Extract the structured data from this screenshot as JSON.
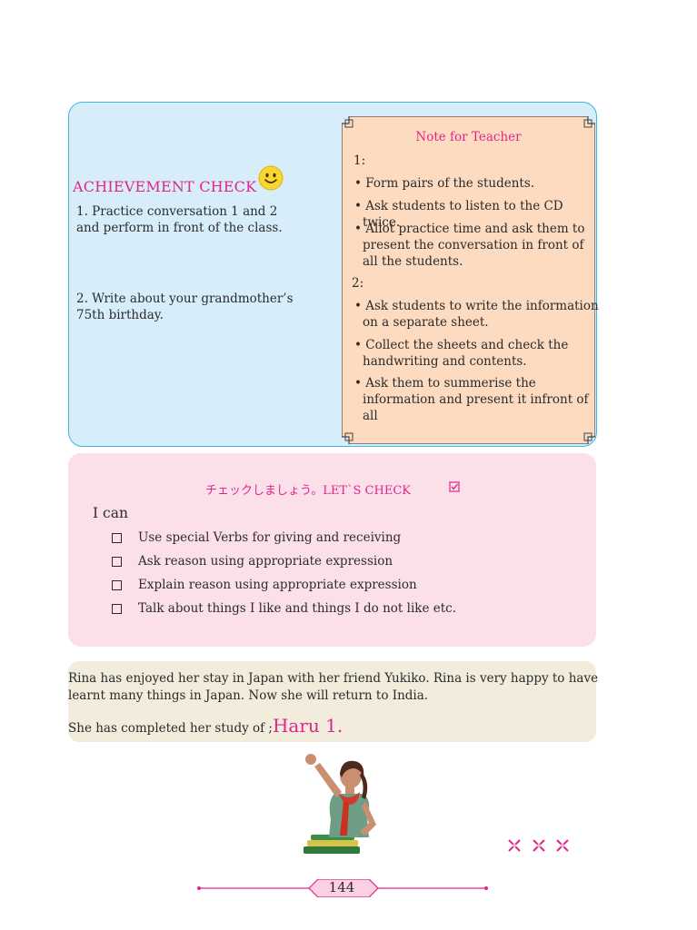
{
  "achievement": {
    "title": "ACHIEVEMENT CHECK",
    "items": [
      "1.   Practice conversation 1 and    2 and perform in front of the class.",
      "2.   Write about your grandmother’s 75th birthday."
    ]
  },
  "note": {
    "title": "Note for Teacher",
    "section1": "1:",
    "bullets1": [
      "• Form pairs of the students.",
      "• Ask students to listen to the CD twice.",
      "• Allot practice time and ask them to present the conversation in front of all the students."
    ],
    "section2": "2:",
    "bullets2": [
      "• Ask  students to write the information on a separate sheet.",
      "• Collect the sheets and check the handwriting and contents.",
      "• Ask them to summerise the information and present it infront of all"
    ]
  },
  "check": {
    "title": "チェックしましょう。LET`S CHECK",
    "intro": "I can",
    "items": [
      "Use special Verbs for giving and receiving",
      "Ask reason using appropriate expression",
      "Explain reason using appropriate expression",
      "Talk about things I like and things I do not like etc."
    ]
  },
  "story": {
    "text": "Rina has enjoyed her stay in Japan with her friend Yukiko. Rina is very happy to have learnt  many things in Japan. Now she will return to India.",
    "completed_prefix": "She has completed her study of ;",
    "completed_title": "Haru 1."
  },
  "page": {
    "number": "144"
  },
  "colors": {
    "accent": "#e0268a",
    "ach_bg": "#d7eefa",
    "note_bg": "#fddbc0",
    "check_bg": "#fbe0ea",
    "story_bg": "#f1ecdb"
  }
}
